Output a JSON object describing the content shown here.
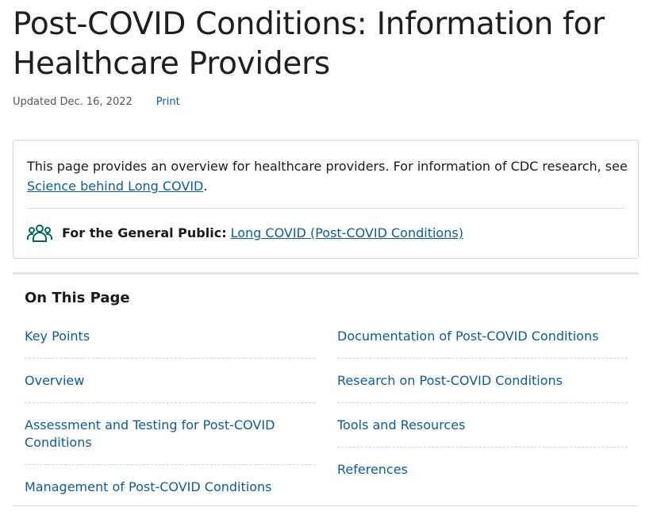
{
  "page": {
    "title": "Post-COVID Conditions: Information for Healthcare Providers",
    "updated": "Updated Dec. 16, 2022",
    "print_label": "Print"
  },
  "info_box": {
    "text_before_link": "This page provides an overview for healthcare providers. For information of CDC research, see ",
    "link_label": "Science behind Long COVID",
    "text_after_link": ".",
    "public_icon": "people-group-icon",
    "public_label": "For the General Public:",
    "public_link": "Long COVID (Post-COVID Conditions)"
  },
  "on_this_page": {
    "title": "On This Page",
    "left": [
      "Key Points",
      "Overview",
      "Assessment and Testing for Post-COVID Conditions",
      "Management of Post-COVID Conditions"
    ],
    "right": [
      "Documentation of Post-COVID Conditions",
      "Research on Post-COVID Conditions",
      "Tools and Resources",
      "References"
    ]
  },
  "colors": {
    "link": "#0b5c9c",
    "icon": "#00695c",
    "border": "#d6d6d6"
  }
}
